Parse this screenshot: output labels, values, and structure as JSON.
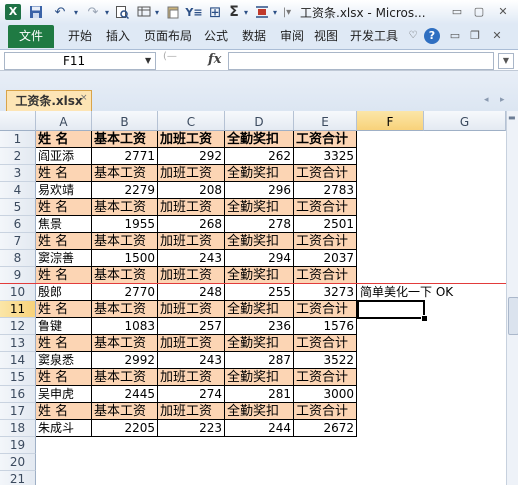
{
  "window": {
    "title": "工资条.xlsx - Micros...",
    "app_icon": "X"
  },
  "qat_icons": [
    "excel-icon",
    "save-icon",
    "undo-icon",
    "redo-icon",
    "print-preview-icon",
    "format-icon",
    "paste-icon",
    "sort-icon",
    "border-icon",
    "sum-icon",
    "align-icon",
    "customize-icon"
  ],
  "ribbon": {
    "file": "文件",
    "tabs": [
      "开始",
      "插入",
      "页面布局",
      "公式",
      "数据",
      "审阅",
      "视图",
      "开发工具"
    ]
  },
  "formula_bar": {
    "name_box": "F11",
    "fx": "fx",
    "value": ""
  },
  "workbook": {
    "tab": "工资条.xlsx"
  },
  "columns": [
    "A",
    "B",
    "C",
    "D",
    "E",
    "F",
    "G"
  ],
  "selected_cell": {
    "col": "F",
    "row": "11"
  },
  "header_row": [
    "姓 名",
    "基本工资",
    "加班工资",
    "全勤奖扣",
    "工资合计"
  ],
  "rows": [
    {
      "num": "1",
      "type": "hdr",
      "cells": [
        "姓 名",
        "基本工资",
        "加班工资",
        "全勤奖扣",
        "工资合计"
      ]
    },
    {
      "num": "2",
      "type": "dat",
      "cells": [
        "阎亚添",
        "2771",
        "292",
        "262",
        "3325"
      ]
    },
    {
      "num": "3",
      "type": "hdr",
      "cells": [
        "姓 名",
        "基本工资",
        "加班工资",
        "全勤奖扣",
        "工资合计"
      ]
    },
    {
      "num": "4",
      "type": "dat",
      "cells": [
        "易欢靖",
        "2279",
        "208",
        "296",
        "2783"
      ]
    },
    {
      "num": "5",
      "type": "hdr",
      "cells": [
        "姓 名",
        "基本工资",
        "加班工资",
        "全勤奖扣",
        "工资合计"
      ]
    },
    {
      "num": "6",
      "type": "dat",
      "cells": [
        "焦景",
        "1955",
        "268",
        "278",
        "2501"
      ]
    },
    {
      "num": "7",
      "type": "hdr",
      "cells": [
        "姓 名",
        "基本工资",
        "加班工资",
        "全勤奖扣",
        "工资合计"
      ]
    },
    {
      "num": "8",
      "type": "dat",
      "cells": [
        "窦淙善",
        "1500",
        "243",
        "294",
        "2037"
      ]
    },
    {
      "num": "9",
      "type": "hdr",
      "cells": [
        "姓 名",
        "基本工资",
        "加班工资",
        "全勤奖扣",
        "工资合计"
      ]
    },
    {
      "num": "10",
      "type": "dat",
      "cells": [
        "殷郎",
        "2770",
        "248",
        "255",
        "3273"
      ],
      "note": "简单美化一下 OK"
    },
    {
      "num": "11",
      "type": "hdr",
      "cells": [
        "姓 名",
        "基本工资",
        "加班工资",
        "全勤奖扣",
        "工资合计"
      ]
    },
    {
      "num": "12",
      "type": "dat",
      "cells": [
        "鲁键",
        "1083",
        "257",
        "236",
        "1576"
      ]
    },
    {
      "num": "13",
      "type": "hdr",
      "cells": [
        "姓 名",
        "基本工资",
        "加班工资",
        "全勤奖扣",
        "工资合计"
      ]
    },
    {
      "num": "14",
      "type": "dat",
      "cells": [
        "窦泉悉",
        "2992",
        "243",
        "287",
        "3522"
      ]
    },
    {
      "num": "15",
      "type": "hdr",
      "cells": [
        "姓 名",
        "基本工资",
        "加班工资",
        "全勤奖扣",
        "工资合计"
      ]
    },
    {
      "num": "16",
      "type": "dat",
      "cells": [
        "吴申虎",
        "2445",
        "274",
        "281",
        "3000"
      ]
    },
    {
      "num": "17",
      "type": "hdr",
      "cells": [
        "姓 名",
        "基本工资",
        "加班工资",
        "全勤奖扣",
        "工资合计"
      ]
    },
    {
      "num": "18",
      "type": "dat",
      "cells": [
        "朱成斗",
        "2205",
        "223",
        "244",
        "2672"
      ]
    },
    {
      "num": "19",
      "type": "empty",
      "cells": []
    },
    {
      "num": "20",
      "type": "empty",
      "cells": []
    },
    {
      "num": "21",
      "type": "empty",
      "cells": []
    }
  ],
  "colors": {
    "header_fill": "#fcd5b4",
    "file_tab": "#1f7a43",
    "separator_line": "#e23b3b"
  }
}
